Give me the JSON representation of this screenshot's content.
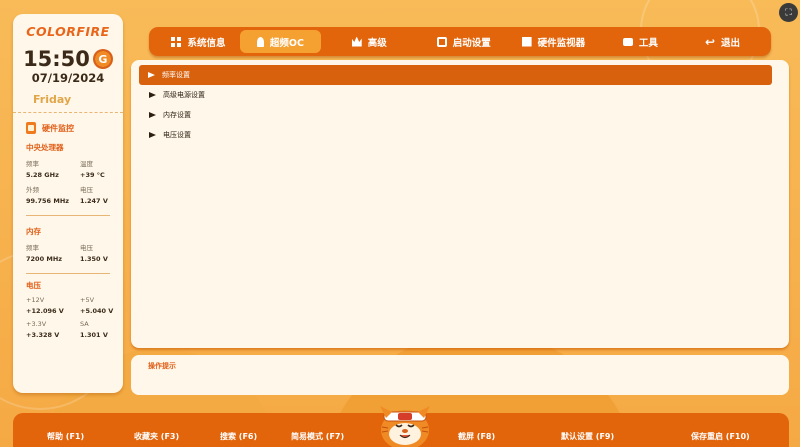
{
  "brand": "COLORFIRE",
  "clock": {
    "time": "15:50",
    "badge": "G",
    "date": "07/19/2024",
    "weekday": "Friday"
  },
  "hw": {
    "title": "硬件监控",
    "cpu": {
      "title": "中央处理器",
      "rows": [
        {
          "l1": "频率",
          "v1": "5.28 GHz",
          "l2": "温度",
          "v2": "+39 °C"
        },
        {
          "l1": "外频",
          "v1": "99.756 MHz",
          "l2": "电压",
          "v2": "1.247 V"
        }
      ]
    },
    "mem": {
      "title": "内存",
      "rows": [
        {
          "l1": "频率",
          "v1": "7200 MHz",
          "l2": "电压",
          "v2": "1.350 V"
        }
      ]
    },
    "volt": {
      "title": "电压",
      "rows": [
        {
          "l1": "+12V",
          "v1": "+12.096 V",
          "l2": "+5V",
          "v2": "+5.040 V"
        },
        {
          "l1": "+3.3V",
          "v1": "+3.328 V",
          "l2": "SA",
          "v2": "1.301 V"
        }
      ]
    }
  },
  "tabs": [
    {
      "label": "系统信息",
      "icon": "grid-icon"
    },
    {
      "label": "超频OC",
      "icon": "rocket-icon",
      "active": true
    },
    {
      "label": "高级",
      "icon": "crown-icon"
    },
    {
      "label": "启动设置",
      "icon": "power-icon"
    },
    {
      "label": "硬件监视器",
      "icon": "monitor-icon"
    },
    {
      "label": "工具",
      "icon": "toolbox-icon"
    },
    {
      "label": "退出",
      "icon": "exit-icon"
    }
  ],
  "menu": [
    {
      "label": "频率设置",
      "selected": true
    },
    {
      "label": "高级电源设置"
    },
    {
      "label": "内存设置"
    },
    {
      "label": "电压设置"
    }
  ],
  "hint": {
    "title": "操作提示"
  },
  "fkeys": [
    "帮助 (F1)",
    "收藏夹 (F3)",
    "搜索 (F6)",
    "简易模式 (F7)",
    "截屏 (F8)",
    "默认设置 (F9)",
    "保存重启 (F10)"
  ],
  "colors": {
    "accent": "#e2650c",
    "accent_light": "#f5a132",
    "panel": "#fff8ea",
    "background": "#f7b24a"
  }
}
